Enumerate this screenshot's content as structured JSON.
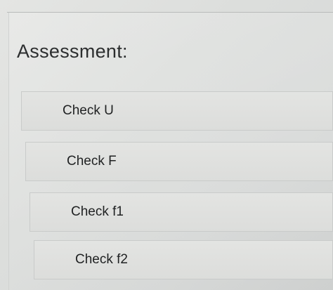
{
  "assessment": {
    "heading": "Assessment:",
    "options": [
      {
        "label": "Check U"
      },
      {
        "label": "Check F"
      },
      {
        "label": "Check f1"
      },
      {
        "label": "Check f2"
      }
    ]
  }
}
